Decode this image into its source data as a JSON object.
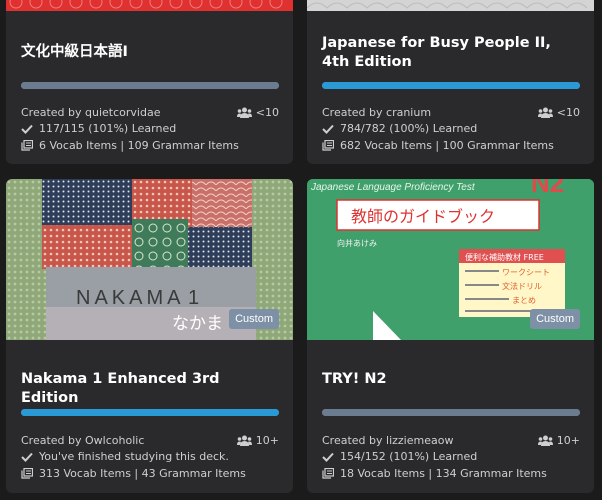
{
  "accent_progress": "#2a9ad6",
  "accent_track": "#6b7c90",
  "cards": [
    {
      "title": "文化中級日本語I",
      "creator": "Created by quietcorvidae",
      "members": "<10",
      "learned_text": "117/115 (101%) Learned",
      "progress": 1.0,
      "progress_color": "#6b7c90",
      "items": "6 Vocab Items | 109 Grammar Items"
    },
    {
      "title": "Japanese for Busy People II, 4th Edition",
      "creator": "Created by cranium",
      "members": "<10",
      "learned_text": "784/782 (100%) Learned",
      "progress": 1.0,
      "progress_color": "#2a9ad6",
      "items": "682 Vocab Items | 100 Grammar Items"
    },
    {
      "title": "Nakama 1 Enhanced 3rd Edition",
      "creator": "Created by Owlcoholic",
      "members": "10+",
      "learned_text": "You've finished studying this deck.",
      "progress": 1.0,
      "progress_color": "#2a9ad6",
      "items": "313 Vocab Items | 43 Grammar Items",
      "badge": "Custom",
      "cover_text_1": "NAKAMA",
      "cover_text_2": "1",
      "cover_text_3": "なかま"
    },
    {
      "title": "TRY! N2",
      "creator": "Created by lizziemeaow",
      "members": "10+",
      "learned_text": "154/152 (101%) Learned",
      "progress": 1.0,
      "progress_color": "#6b7c90",
      "items": "18 Vocab Items | 134 Grammar Items",
      "badge": "Custom",
      "cover_text_1": "Japanese Language Proficiency Test",
      "cover_text_2": "N2",
      "cover_text_3": "教師のガイドブック",
      "cover_text_4": "向井あけみ",
      "cover_text_5": "便利な補助教材 FREE",
      "cover_text_6": "ワークシート",
      "cover_text_7": "文法ドリル",
      "cover_text_8": "まとめ"
    }
  ]
}
